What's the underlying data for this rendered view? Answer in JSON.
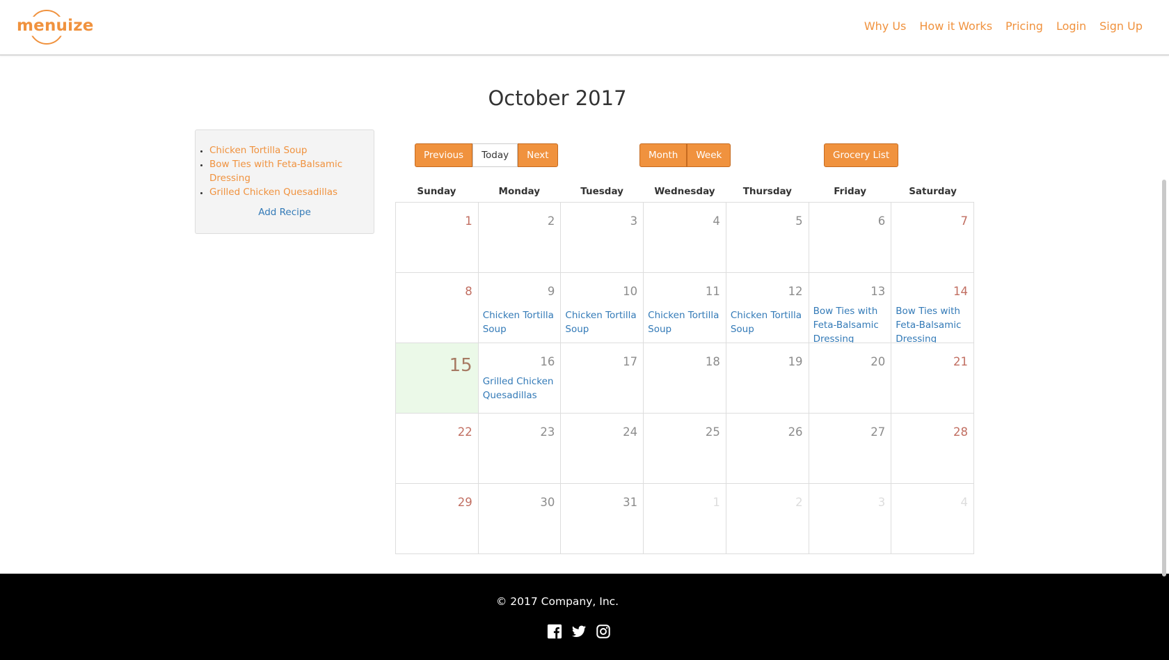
{
  "brand": {
    "name": "menuize",
    "color": "#f0923e"
  },
  "nav": {
    "links": [
      "Why Us",
      "How it Works",
      "Pricing",
      "Login",
      "Sign Up"
    ]
  },
  "title": "October 2017",
  "sidebar": {
    "recipes": [
      "Chicken Tortilla Soup",
      "Bow Ties with Feta-Balsamic Dressing",
      "Grilled Chicken Quesadillas"
    ],
    "add_label": "Add Recipe"
  },
  "toolbar": {
    "previous": "Previous",
    "today": "Today",
    "next": "Next",
    "month": "Month",
    "week": "Week",
    "grocery": "Grocery List"
  },
  "calendar": {
    "weekdays": [
      "Sunday",
      "Monday",
      "Tuesday",
      "Wednesday",
      "Thursday",
      "Friday",
      "Saturday"
    ],
    "days": [
      {
        "n": "1",
        "weekend": true
      },
      {
        "n": "2"
      },
      {
        "n": "3"
      },
      {
        "n": "4"
      },
      {
        "n": "5"
      },
      {
        "n": "6"
      },
      {
        "n": "7",
        "weekend": true
      },
      {
        "n": "8",
        "weekend": true
      },
      {
        "n": "9",
        "event": "Chicken Tortilla Soup"
      },
      {
        "n": "10",
        "event": "Chicken Tortilla Soup"
      },
      {
        "n": "11",
        "event": "Chicken Tortilla Soup"
      },
      {
        "n": "12",
        "event": "Chicken Tortilla Soup"
      },
      {
        "n": "13",
        "event": "Bow Ties with Feta-Balsamic Dressing"
      },
      {
        "n": "14",
        "weekend": true,
        "event": "Bow Ties with Feta-Balsamic Dressing"
      },
      {
        "n": "15",
        "weekend": true,
        "today": true
      },
      {
        "n": "16",
        "event": "Grilled Chicken Quesadillas"
      },
      {
        "n": "17"
      },
      {
        "n": "18"
      },
      {
        "n": "19"
      },
      {
        "n": "20"
      },
      {
        "n": "21",
        "weekend": true
      },
      {
        "n": "22",
        "weekend": true
      },
      {
        "n": "23"
      },
      {
        "n": "24"
      },
      {
        "n": "25"
      },
      {
        "n": "26"
      },
      {
        "n": "27"
      },
      {
        "n": "28",
        "weekend": true
      },
      {
        "n": "29",
        "weekend": true
      },
      {
        "n": "30"
      },
      {
        "n": "31"
      },
      {
        "n": "1",
        "other": true
      },
      {
        "n": "2",
        "other": true
      },
      {
        "n": "3",
        "other": true
      },
      {
        "n": "4",
        "other": true
      }
    ]
  },
  "footer": {
    "copyright": "© 2017 Company, Inc.",
    "social": [
      "facebook-icon",
      "twitter-icon",
      "instagram-icon"
    ]
  }
}
